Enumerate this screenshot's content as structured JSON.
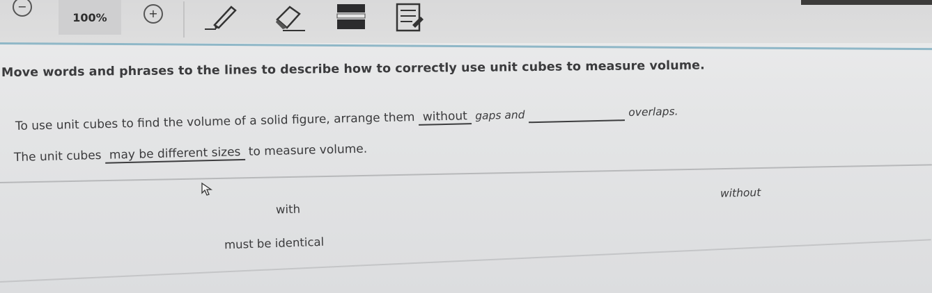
{
  "toolbar": {
    "zoom_out_icon": "zoom-out-icon",
    "zoom_level": "100%",
    "zoom_in_icon": "zoom-in-icon",
    "zoom_out_glyph": "−",
    "zoom_in_glyph": "+",
    "tools": [
      "highlighter-icon",
      "eraser-icon",
      "line-reader-icon",
      "notepad-icon"
    ]
  },
  "instruction": "Move words and phrases to the lines to describe how to correctly use unit cubes to measure volume.",
  "sentence1": {
    "prefix": "To use unit cubes to find the volume of a solid figure, arrange them",
    "blank1": "without",
    "middle": "gaps and",
    "blank2": "",
    "suffix": "overlaps."
  },
  "sentence2": {
    "prefix": "The unit cubes",
    "blank": "may be different sizes",
    "suffix": "to measure volume."
  },
  "word_bank": {
    "without": "without",
    "with": "with",
    "must_be_identical": "must be identical"
  },
  "colors": {
    "accent_line": "#8fb7c7",
    "text": "#3a3a3c"
  }
}
